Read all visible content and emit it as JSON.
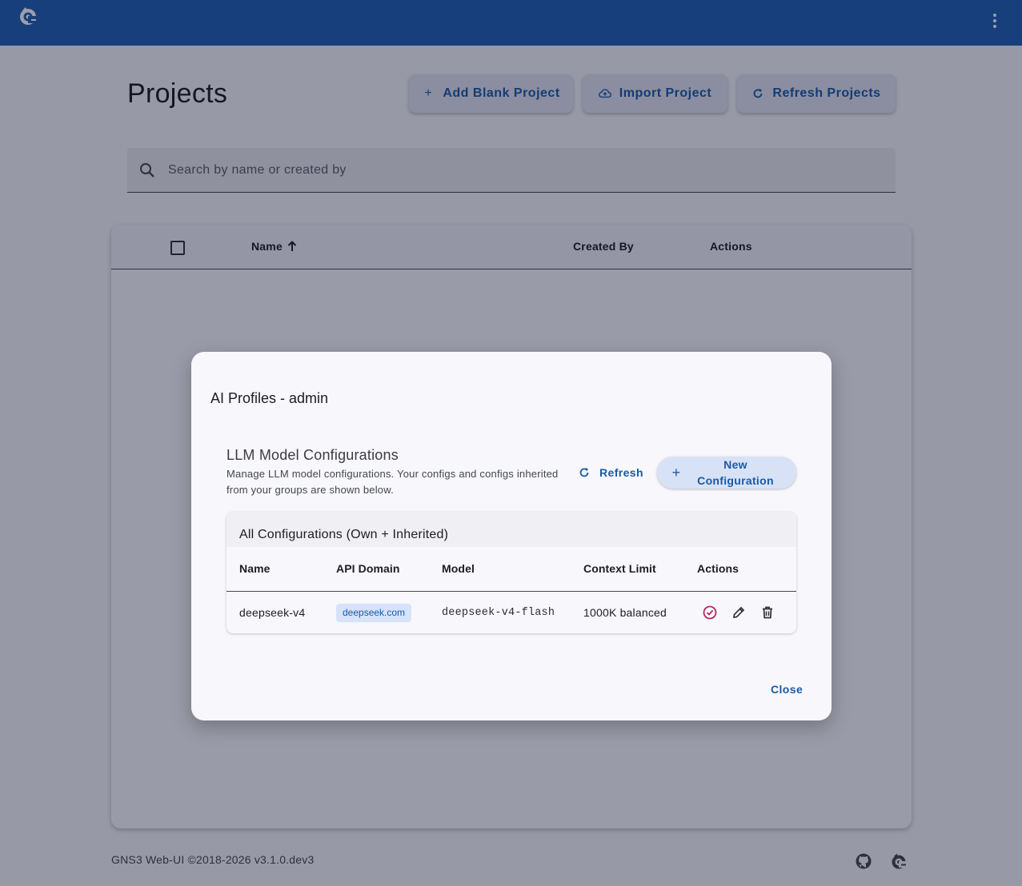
{
  "colors": {
    "toolbar": "#1d5fb4",
    "primary": "#1a5aa6",
    "approve_icon": "#b0295e",
    "chip_bg": "#d6e3fa"
  },
  "toolbar": {
    "logo_icon": "gns3-chameleon-icon",
    "menu_icon": "more-vert-icon"
  },
  "page": {
    "title": "Projects",
    "buttons": {
      "add_blank": "Add Blank Project",
      "import": "Import Project",
      "refresh": "Refresh Projects"
    },
    "search": {
      "placeholder": "Search by name or created by",
      "value": ""
    },
    "table": {
      "columns": [
        "Name",
        "Created By",
        "Actions"
      ]
    }
  },
  "footer": {
    "text": "GNS3 Web-UI ©2018-2026 v3.1.0.dev3",
    "icons": [
      "github-icon",
      "gns3-chameleon-icon"
    ]
  },
  "dialog": {
    "title": "AI Profiles - admin",
    "section_title": "LLM Model Configurations",
    "section_desc": "Manage LLM model configurations. Your configs and configs inherited from your groups are shown below.",
    "refresh_label": "Refresh",
    "new_config_label": "New Configuration",
    "card_title": "All Configurations (Own + Inherited)",
    "columns": [
      "Name",
      "API Domain",
      "Model",
      "Context Limit",
      "Actions"
    ],
    "rows": [
      {
        "name": "deepseek-v4",
        "api_domain": "deepseek.com",
        "model": "deepseek-v4-flash",
        "context_limit": "1000K balanced",
        "actions": [
          "check-circle-icon",
          "pencil-icon",
          "trash-icon"
        ]
      }
    ],
    "close_label": "Close"
  }
}
